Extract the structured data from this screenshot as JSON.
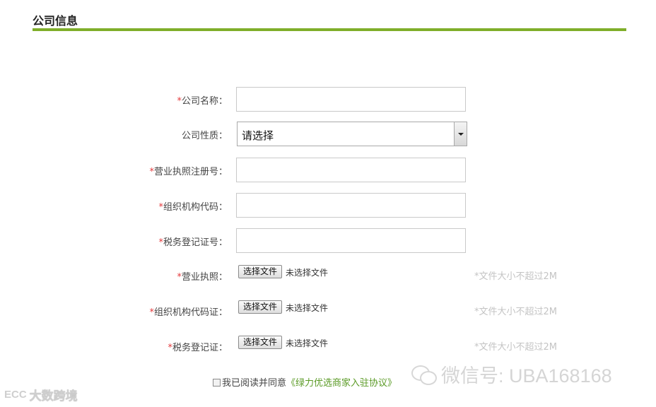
{
  "section": {
    "title": "公司信息",
    "accent_color": "#7fae2a"
  },
  "form": {
    "required_mark": "*",
    "required_color": "#e4393c",
    "company_name": {
      "label": "公司名称：",
      "value": "",
      "required": true
    },
    "company_type": {
      "label": "公司性质：",
      "selected": "请选择",
      "required": false
    },
    "business_license_number": {
      "label": "营业执照注册号：",
      "value": "",
      "required": true
    },
    "organization_code": {
      "label": "组织机构代码：",
      "value": "",
      "required": true
    },
    "tax_registration_number": {
      "label": "税务登记证号：",
      "value": "",
      "required": true
    },
    "business_license_file": {
      "label": "营业执照：",
      "button_label": "选择文件",
      "status": "未选择文件",
      "hint": "*文件大小不超过2M",
      "required": true
    },
    "organization_code_file": {
      "label": "组织机构代码证：",
      "button_label": "选择文件",
      "status": "未选择文件",
      "hint": "*文件大小不超过2M",
      "required": true
    },
    "tax_registration_file": {
      "label": "税务登记证：",
      "button_label": "选择文件",
      "status": "未选择文件",
      "hint": "*文件大小不超过2M",
      "required": true
    }
  },
  "agreement": {
    "text": "我已阅读并同意",
    "link": "《绿力优选商家入驻协议》",
    "link_color": "#5a9a25",
    "checked": false
  },
  "watermarks": {
    "right_icon": "wechat-icon",
    "right_text": "微信号: UBA168168",
    "left_logo": "ECC",
    "left_text": "大数跨境"
  }
}
